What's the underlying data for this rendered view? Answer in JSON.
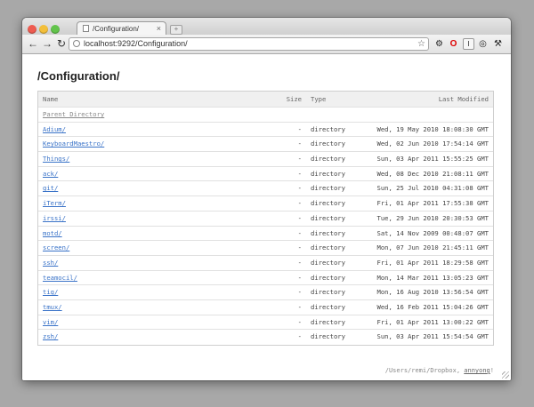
{
  "browser": {
    "tab_title": "/Configuration/",
    "tab_close": "×",
    "newtab_label": "+",
    "url": "localhost:9292/Configuration/",
    "ext_opera": "O",
    "ext_ibox": "I"
  },
  "page": {
    "title": "/Configuration/",
    "columns": {
      "name": "Name",
      "size": "Size",
      "type": "Type",
      "modified": "Last Modified"
    },
    "parent_label": "Parent Directory",
    "entries": [
      {
        "name": "Adium/",
        "size": "-",
        "type": "directory",
        "modified": "Wed, 19 May 2010 18:08:30 GMT"
      },
      {
        "name": "KeyboardMaestro/",
        "size": "-",
        "type": "directory",
        "modified": "Wed, 02 Jun 2010 17:54:14 GMT"
      },
      {
        "name": "Things/",
        "size": "-",
        "type": "directory",
        "modified": "Sun, 03 Apr 2011 15:55:25 GMT"
      },
      {
        "name": "ack/",
        "size": "-",
        "type": "directory",
        "modified": "Wed, 08 Dec 2010 21:08:11 GMT"
      },
      {
        "name": "git/",
        "size": "-",
        "type": "directory",
        "modified": "Sun, 25 Jul 2010 04:31:08 GMT"
      },
      {
        "name": "iTerm/",
        "size": "-",
        "type": "directory",
        "modified": "Fri, 01 Apr 2011 17:55:38 GMT"
      },
      {
        "name": "irssi/",
        "size": "-",
        "type": "directory",
        "modified": "Tue, 29 Jun 2010 20:30:53 GMT"
      },
      {
        "name": "motd/",
        "size": "-",
        "type": "directory",
        "modified": "Sat, 14 Nov 2009 00:48:07 GMT"
      },
      {
        "name": "screen/",
        "size": "-",
        "type": "directory",
        "modified": "Mon, 07 Jun 2010 21:45:11 GMT"
      },
      {
        "name": "ssh/",
        "size": "-",
        "type": "directory",
        "modified": "Fri, 01 Apr 2011 18:29:58 GMT"
      },
      {
        "name": "teamocil/",
        "size": "-",
        "type": "directory",
        "modified": "Mon, 14 Mar 2011 13:05:23 GMT"
      },
      {
        "name": "tig/",
        "size": "-",
        "type": "directory",
        "modified": "Mon, 16 Aug 2010 13:56:54 GMT"
      },
      {
        "name": "tmux/",
        "size": "-",
        "type": "directory",
        "modified": "Wed, 16 Feb 2011 15:04:26 GMT"
      },
      {
        "name": "vim/",
        "size": "-",
        "type": "directory",
        "modified": "Fri, 01 Apr 2011 13:00:22 GMT"
      },
      {
        "name": "zsh/",
        "size": "-",
        "type": "directory",
        "modified": "Sun, 03 Apr 2011 15:54:54 GMT"
      }
    ],
    "footer_path": "/Users/remi/Dropbox, ",
    "footer_link": "annyong",
    "footer_end": "!"
  }
}
